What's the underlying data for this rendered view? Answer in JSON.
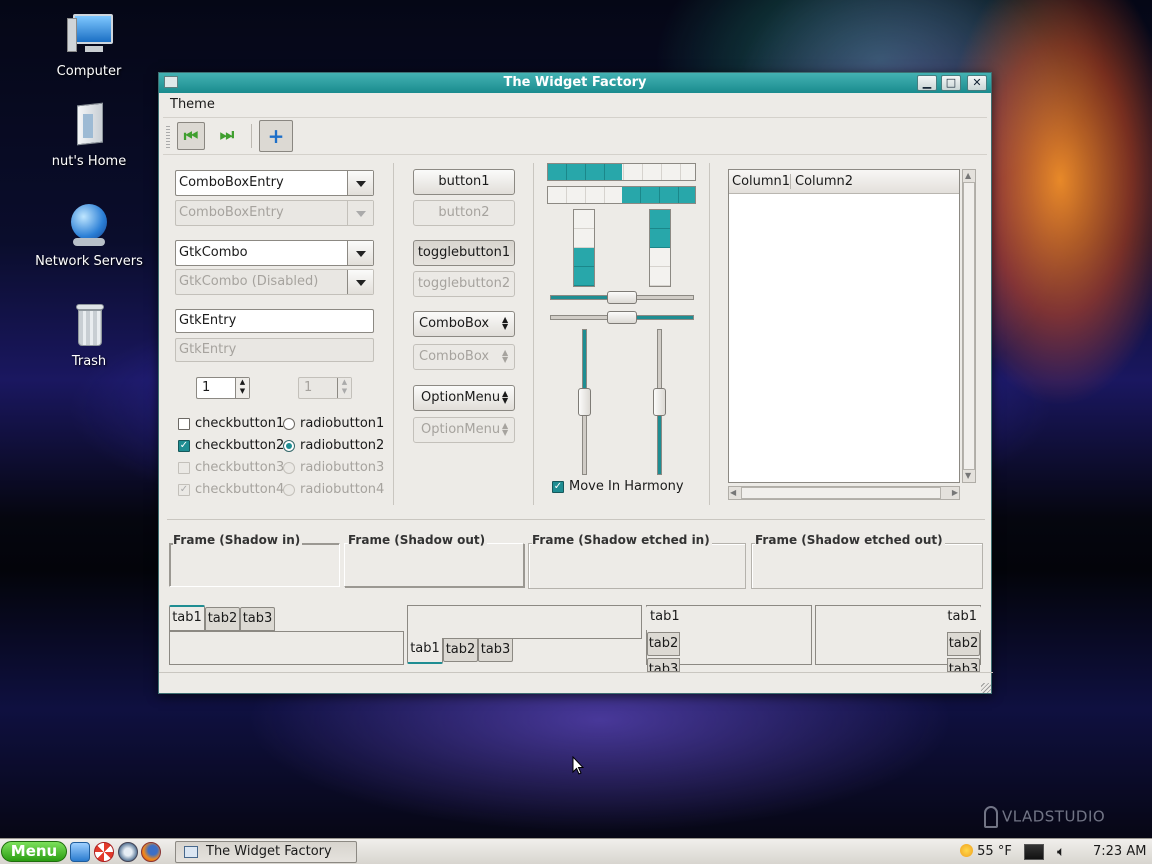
{
  "desktop": {
    "icons": [
      {
        "label": "Computer"
      },
      {
        "label": "nut's Home"
      },
      {
        "label": "Network Servers"
      },
      {
        "label": "Trash"
      }
    ],
    "watermark": "VLADSTUDIO"
  },
  "window": {
    "title": "The Widget Factory",
    "menu": [
      "Theme"
    ],
    "toolbar": {
      "icons": [
        "goto-first-icon",
        "goto-last-icon",
        "add-icon"
      ]
    },
    "left": {
      "combo_entry": "ComboBoxEntry",
      "combo_entry_disabled": "ComboBoxEntry",
      "gtk_combo": "GtkCombo",
      "gtk_combo_disabled": "GtkCombo (Disabled)",
      "entry": "GtkEntry",
      "entry_disabled": "GtkEntry",
      "spin_value": "1",
      "spin_disabled_value": "1",
      "checks": [
        {
          "label": "checkbutton1",
          "checked": false
        },
        {
          "label": "checkbutton2",
          "checked": true
        },
        {
          "label": "checkbutton3",
          "checked": false
        },
        {
          "label": "checkbutton4",
          "checked": true
        }
      ],
      "radios": [
        {
          "label": "radiobutton1",
          "selected": false
        },
        {
          "label": "radiobutton2",
          "selected": true
        },
        {
          "label": "radiobutton3",
          "selected": false
        },
        {
          "label": "radiobutton4",
          "selected": true
        }
      ]
    },
    "middle": {
      "button1": "button1",
      "button2": "button2",
      "toggle1": "togglebutton1",
      "toggle2": "togglebutton2",
      "combobox": "ComboBox",
      "combobox_disabled": "ComboBox",
      "optionmenu": "OptionMenu",
      "optionmenu_disabled": "OptionMenu"
    },
    "ranges": {
      "progress_h": [
        0.5,
        0.5
      ],
      "progress_v": [
        0.5,
        0.5
      ],
      "scale_h": [
        0.5,
        0.5
      ],
      "scale_v": [
        0.5,
        0.5
      ],
      "move_in_harmony": "Move In Harmony"
    },
    "tree": {
      "columns": [
        "Column1",
        "Column2"
      ]
    },
    "frames": [
      "Frame (Shadow in)",
      "Frame (Shadow out)",
      "Frame (Shadow etched in)",
      "Frame (Shadow etched out)"
    ],
    "tabs": [
      "tab1",
      "tab2",
      "tab3"
    ]
  },
  "taskbar": {
    "menu_label": "Menu",
    "task": "The Widget Factory",
    "weather": "55 °F",
    "clock": "7:23 AM"
  },
  "colors": {
    "accent": "#1f8d92",
    "title_bar": "#2a9a9c",
    "menu_button": "#3cb81c"
  }
}
